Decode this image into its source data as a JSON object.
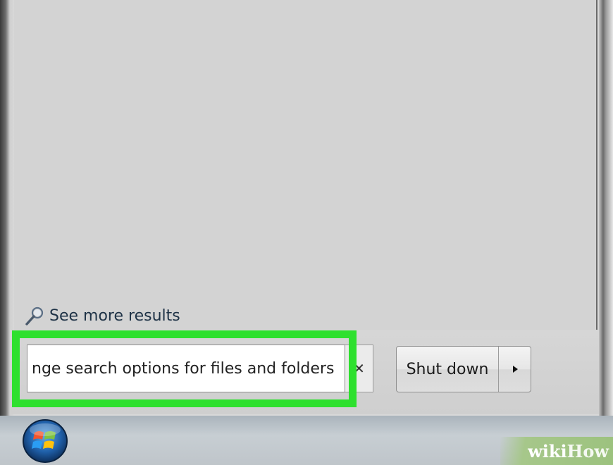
{
  "start_menu": {
    "see_more_results": "See more results",
    "search_value": "nge search options for files and folders",
    "clear_icon": "close-icon",
    "shutdown_label": "Shut down",
    "shutdown_arrow_icon": "triangle-right-icon"
  },
  "taskbar": {
    "start_icon": "windows-orb-icon"
  },
  "watermark": {
    "wiki": "wiki",
    "how": "How"
  },
  "colors": {
    "highlight": "#2ee02e",
    "menu_bg": "#d3d3d3"
  }
}
